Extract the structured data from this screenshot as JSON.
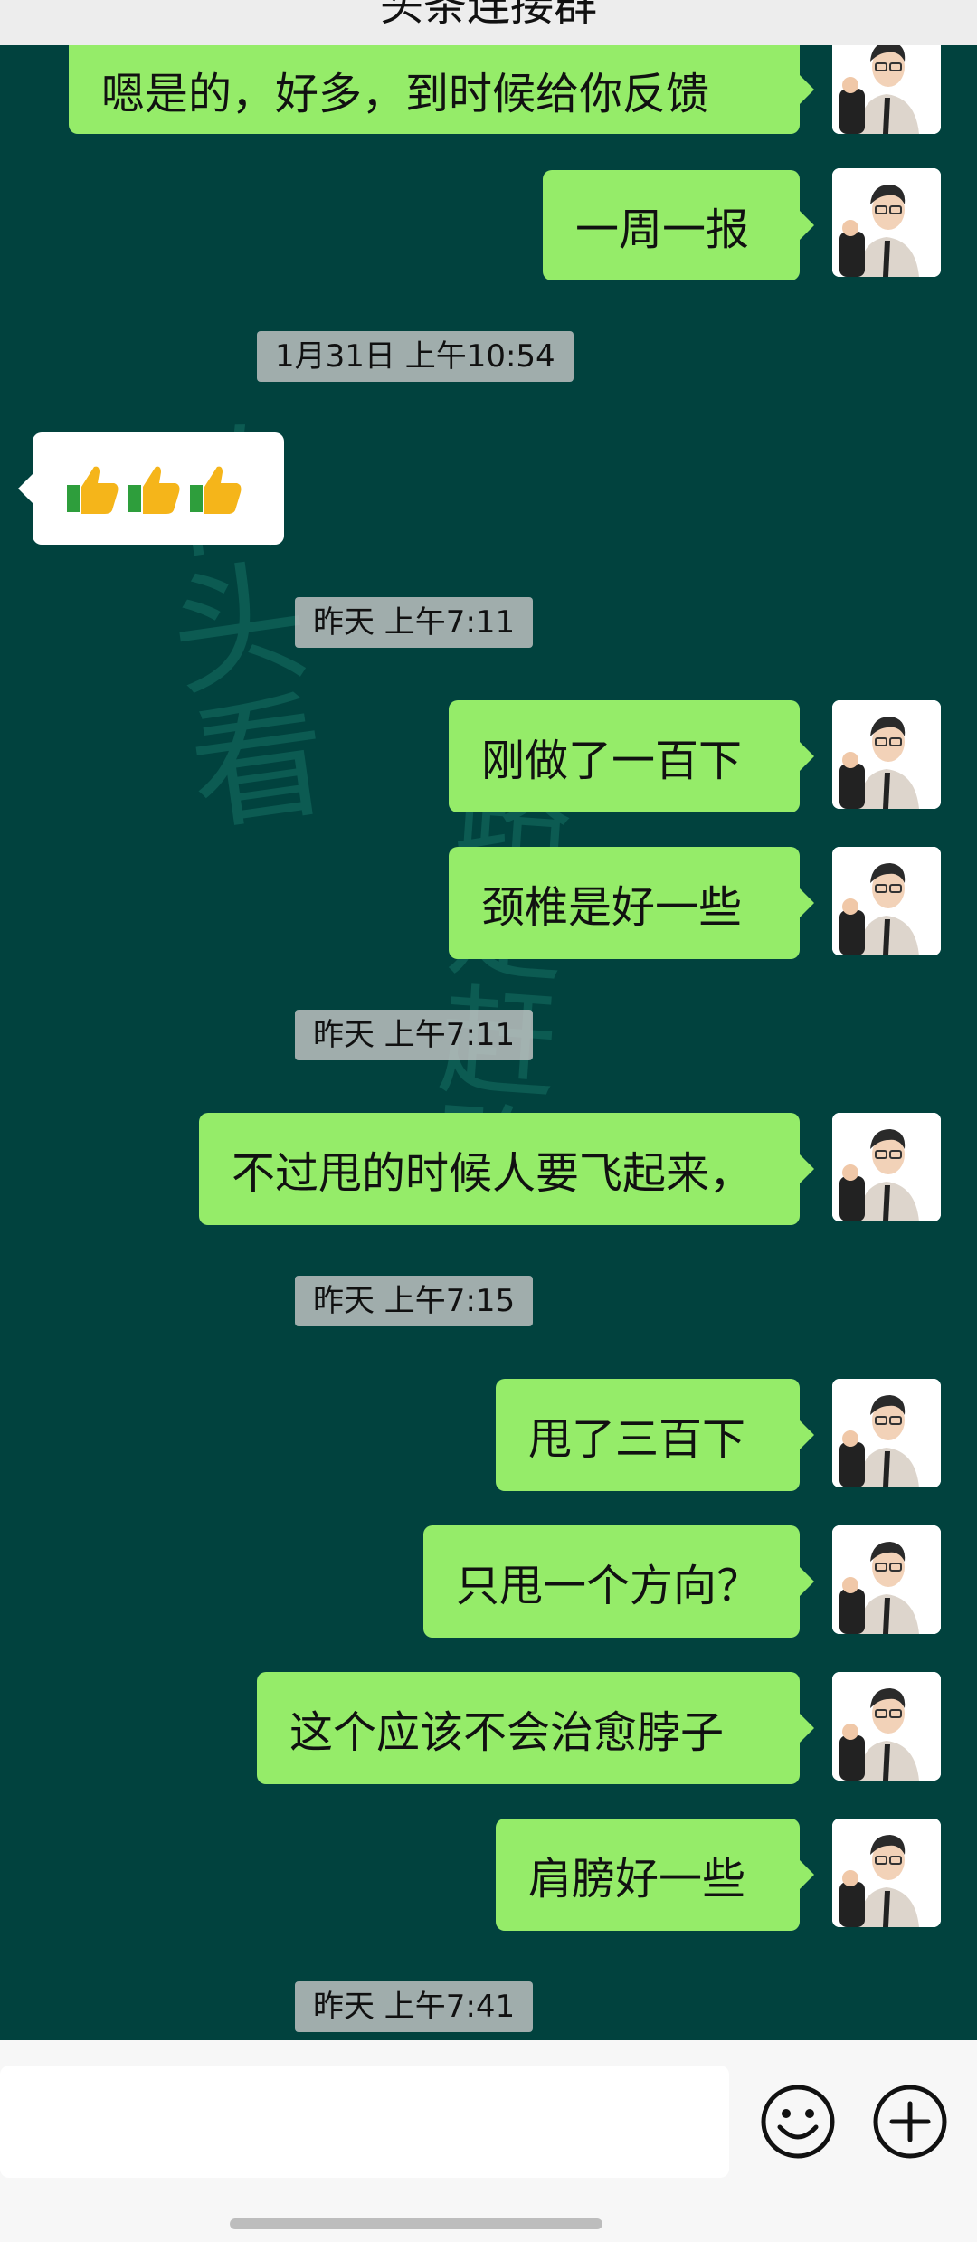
{
  "header": {
    "title": "头条连接群"
  },
  "watermark": {
    "left": "转头看",
    "right": "路走赶路"
  },
  "input": {
    "placeholder": ""
  },
  "messages": [
    {
      "type": "self",
      "text": "嗯是的，好多，到时候给你反馈"
    },
    {
      "type": "self",
      "text": "一周一报"
    },
    {
      "type": "time",
      "text": "1月31日 上午10:54"
    },
    {
      "type": "other",
      "emoji": "👍👍👍"
    },
    {
      "type": "time",
      "text": "昨天 上午7:11"
    },
    {
      "type": "self",
      "text": "刚做了一百下"
    },
    {
      "type": "self",
      "text": "颈椎是好一些"
    },
    {
      "type": "time",
      "text": "昨天 上午7:11"
    },
    {
      "type": "self",
      "text": "不过甩的时候人要飞起来，"
    },
    {
      "type": "time",
      "text": "昨天 上午7:15"
    },
    {
      "type": "self",
      "text": "甩了三百下"
    },
    {
      "type": "self",
      "text": "只甩一个方向？"
    },
    {
      "type": "self",
      "text": "这个应该不会治愈脖子"
    },
    {
      "type": "self",
      "text": "肩膀好一些"
    },
    {
      "type": "time",
      "text": "昨天 上午7:41"
    }
  ],
  "colors": {
    "background": "#01423e",
    "self_bubble": "#95ec69",
    "other_bubble": "#ffffff",
    "timestamp_bg": "#c8c8c8"
  },
  "icons": {
    "emoji": "smiley-face-icon",
    "plus": "plus-circle-icon",
    "avatar": "user-avatar"
  }
}
